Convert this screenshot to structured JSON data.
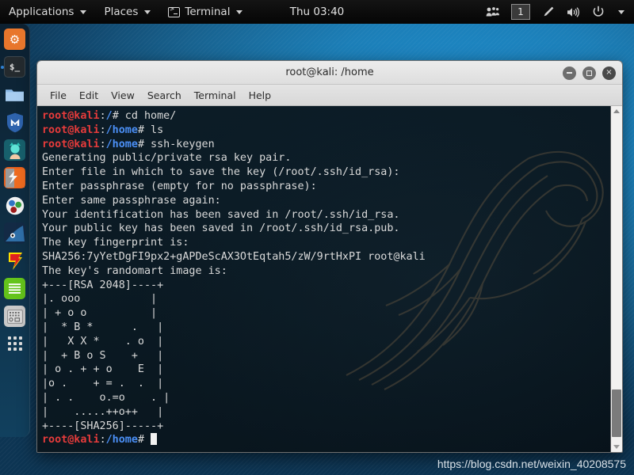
{
  "panel": {
    "applications_label": "Applications",
    "places_label": "Places",
    "terminal_label": "Terminal",
    "clock": "Thu 03:40",
    "workspace": "1",
    "icons": {
      "terminal": "terminal-icon",
      "users": "users-icon",
      "pen": "pen-icon",
      "volume": "volume-icon",
      "power": "power-icon",
      "caret": "chevron-down-icon"
    }
  },
  "dock": {
    "items": [
      {
        "name": "firefox",
        "glyph": "ƒ",
        "bg": "#e8762c",
        "fg": "#ffffff",
        "running": false
      },
      {
        "name": "terminal",
        "glyph": "$_",
        "bg": "#242a2e",
        "fg": "#dcdcdc",
        "running": true
      },
      {
        "name": "files",
        "glyph": "▬",
        "bg": "#7fb0e0",
        "fg": "#ffffff",
        "running": false
      },
      {
        "name": "metasploit",
        "glyph": "M",
        "bg": "#2c5fa8",
        "fg": "#ffffff",
        "running": false
      },
      {
        "name": "armitage",
        "glyph": "●",
        "bg": "#16606b",
        "fg": "#57e0d4",
        "running": false
      },
      {
        "name": "burpsuite",
        "glyph": "◨",
        "bg": "#e8601c",
        "fg": "#ffffff",
        "running": false
      },
      {
        "name": "beef",
        "glyph": "●",
        "bg": "#f0f0f0",
        "fg": "#2a7d3a",
        "running": false
      },
      {
        "name": "wireshark",
        "glyph": "◉",
        "bg": "#1b3a63",
        "fg": "#7cc3f0",
        "running": false
      },
      {
        "name": "faraday",
        "glyph": "F",
        "bg": "#d91f1f",
        "fg": "#ffe600",
        "running": false
      },
      {
        "name": "text-editor",
        "glyph": "≡",
        "bg": "#64c41b",
        "fg": "#ffffff",
        "running": false
      },
      {
        "name": "calculator",
        "glyph": "⊞",
        "bg": "#cfcfcf",
        "fg": "#3a3a3a",
        "running": false
      }
    ],
    "show_apps_label": "show-applications-grid"
  },
  "window": {
    "title": "root@kali: /home",
    "menu": [
      "File",
      "Edit",
      "View",
      "Search",
      "Terminal",
      "Help"
    ],
    "buttons": {
      "minimize": "minimize",
      "maximize": "maximize",
      "close": "×"
    }
  },
  "terminal": {
    "user_host": "root@kali",
    "colors": {
      "prompt_user": "#e63b3b",
      "prompt_path": "#4b8ff5",
      "text": "#d8d8d8",
      "background": "#0b1a24"
    },
    "lines": [
      {
        "type": "prompt",
        "path": "/",
        "sigil": "#",
        "command": " cd home/"
      },
      {
        "type": "prompt",
        "path": "/home",
        "sigil": "#",
        "command": " ls"
      },
      {
        "type": "prompt",
        "path": "/home",
        "sigil": "#",
        "command": " ssh-keygen"
      },
      {
        "type": "out",
        "text": "Generating public/private rsa key pair."
      },
      {
        "type": "out",
        "text": "Enter file in which to save the key (/root/.ssh/id_rsa): "
      },
      {
        "type": "out",
        "text": "Enter passphrase (empty for no passphrase): "
      },
      {
        "type": "out",
        "text": "Enter same passphrase again: "
      },
      {
        "type": "out",
        "text": "Your identification has been saved in /root/.ssh/id_rsa."
      },
      {
        "type": "out",
        "text": "Your public key has been saved in /root/.ssh/id_rsa.pub."
      },
      {
        "type": "out",
        "text": "The key fingerprint is:"
      },
      {
        "type": "out",
        "text": "SHA256:7yYetDgFI9px2+gAPDeScAX3OtEqtah5/zW/9rtHxPI root@kali"
      },
      {
        "type": "out",
        "text": "The key's randomart image is:"
      },
      {
        "type": "out",
        "text": "+---[RSA 2048]----+"
      },
      {
        "type": "out",
        "text": "|. ooo           |"
      },
      {
        "type": "out",
        "text": "| + o o          |"
      },
      {
        "type": "out",
        "text": "|  * B *      .   |"
      },
      {
        "type": "out",
        "text": "|   X X *    . o  |"
      },
      {
        "type": "out",
        "text": "|  + B o S    +   |"
      },
      {
        "type": "out",
        "text": "| o . + + o    E  |"
      },
      {
        "type": "out",
        "text": "|o .    + = .  .  |"
      },
      {
        "type": "out",
        "text": "| . .    o.=o    . |"
      },
      {
        "type": "out",
        "text": "|    .....++o++   |"
      },
      {
        "type": "out",
        "text": "+----[SHA256]-----+"
      }
    ],
    "final_prompt": {
      "path": "/home",
      "sigil": "#",
      "cursor": "block"
    }
  },
  "watermark": {
    "text": "https://blog.csdn.net/weixin_40208575"
  }
}
